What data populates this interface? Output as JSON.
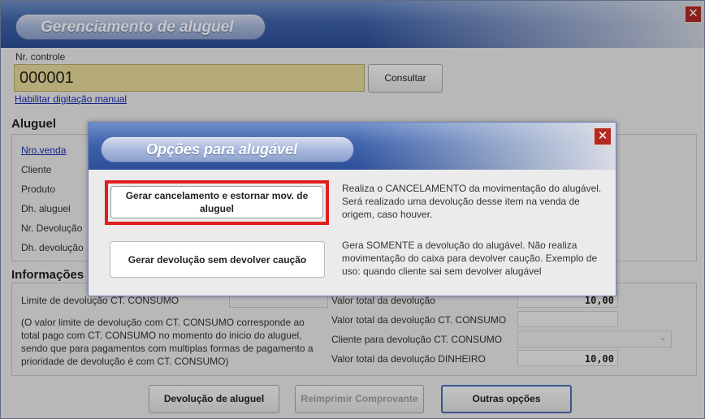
{
  "window": {
    "title": "Gerenciamento de aluguel",
    "close_symbol": "✕"
  },
  "controle": {
    "label": "Nr. controle",
    "value": "000001",
    "consultar_label": "Consultar",
    "manual_link": "Habilitar digitação manual"
  },
  "aluguel": {
    "section_title": "Aluguel",
    "fields": [
      "Nro.venda",
      "Cliente",
      "Produto",
      "Dh. aluguel",
      "Nr. Devolução",
      "Dh. devolução"
    ]
  },
  "informacoes": {
    "section_title": "Informações",
    "limite_label": "Limite de devolução CT. CONSUMO",
    "note": "(O valor limite de devolução com CT. CONSUMO corresponde ao total pago com CT. CONSUMO no momento do inicio do aluguel, sendo que para pagamentos com multiplas formas de pagamento a prioridade de devolução é com CT. CONSUMO)",
    "rows": [
      {
        "label": "Valor total da devolução",
        "value": "10,00"
      },
      {
        "label": "Valor total da devolução CT. CONSUMO",
        "value": ""
      },
      {
        "label": "Cliente para devolução CT. CONSUMO",
        "value": ""
      },
      {
        "label": "Valor total da devolução DINHEIRO",
        "value": "10,00"
      }
    ]
  },
  "footer": {
    "devolucao_label": "Devolução de aluguel",
    "reimprimir_label": "Reimprimir Comprovante",
    "outras_label": "Outras opções"
  },
  "dialog": {
    "title": "Opções para alugável",
    "close_symbol": "✕",
    "options": [
      {
        "button_label": "Gerar cancelamento e estornar mov. de aluguel",
        "description": "Realiza o CANCELAMENTO da movimentação do alugável. Será realizado uma devolução desse item na venda de origem, caso houver."
      },
      {
        "button_label": "Gerar devolução sem devolver caução",
        "description": "Gera SOMENTE a devolução do alugável. Não realiza movimentação do caixa para devolver caução. Exemplo de uso: quando cliente sai sem devolver alugável"
      }
    ]
  }
}
